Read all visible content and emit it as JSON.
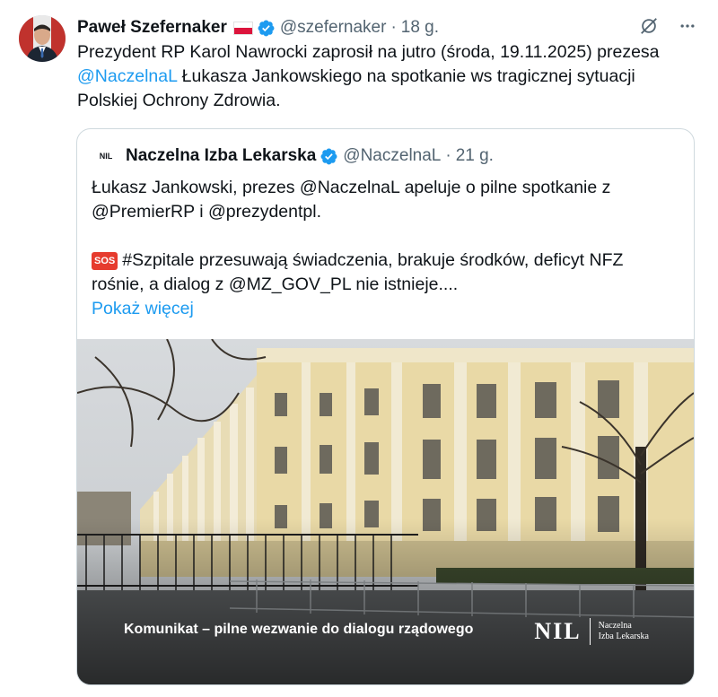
{
  "tweet": {
    "author_name": "Paweł Szefernaker",
    "handle": "@szefernaker",
    "separator": "·",
    "time": "18 g.",
    "text_part1": "Prezydent RP Karol Nawrocki zaprosił na jutro (środa, 19.11.2025) prezesa",
    "mention": "@NaczelnaL",
    "text_part2": " Łukasza Jankowskiego na spotkanie ws tragicznej sytuacji Polskiej Ochrony Zdrowia."
  },
  "quote": {
    "logo_text": "NIL",
    "author_name": "Naczelna Izba Lekarska",
    "handle": "@NaczelnaL",
    "separator": "·",
    "time": "21 g.",
    "paragraph1": "Łukasz Jankowski, prezes @NaczelnaL apeluje o pilne spotkanie z @PremierRP  i @prezydentpl.",
    "sos_badge": "SOS",
    "paragraph2": "#Szpitale przesuwają świadczenia, brakuje środków, deficyt NFZ rośnie, a dialog z @MZ_GOV_PL nie istnieje....",
    "show_more": "Pokaż więcej",
    "image_caption": "Komunikat – pilne wezwanie do dialogu rządowego",
    "image_logo_big": "NIL",
    "image_logo_line1": "Naczelna",
    "image_logo_line2": "Izba Lekarska"
  },
  "colors": {
    "accent": "#1d9bf0",
    "text": "#0f1419",
    "muted": "#536471",
    "border": "#cfd9de"
  },
  "icons": [
    "verified-badge-icon",
    "poland-flag-icon",
    "grok-icon",
    "more-icon"
  ]
}
